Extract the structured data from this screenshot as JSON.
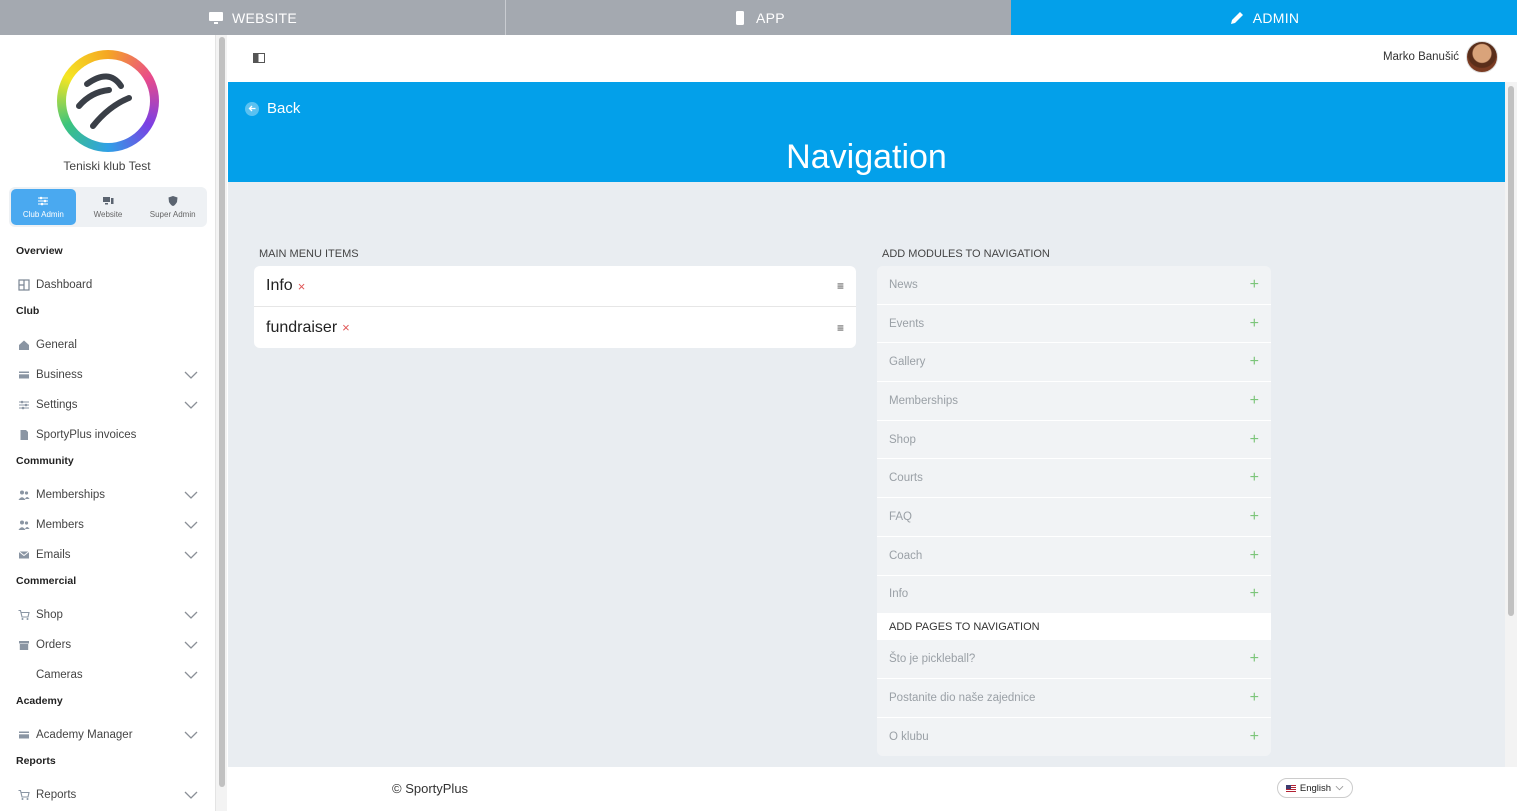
{
  "topbar": {
    "tabs": [
      {
        "label": "WEBSITE",
        "icon": "monitor-icon"
      },
      {
        "label": "APP",
        "icon": "phone-icon"
      },
      {
        "label": "ADMIN",
        "icon": "pencil-icon",
        "active": true
      }
    ],
    "active_color": "#03a0ea"
  },
  "sidebar": {
    "club_name": "Teniski klub Test",
    "modes": [
      {
        "label": "Club Admin",
        "icon": "sliders-icon",
        "active": true
      },
      {
        "label": "Website",
        "icon": "devices-icon"
      },
      {
        "label": "Super Admin",
        "icon": "shield-icon"
      }
    ],
    "sections": {
      "overview": "Overview",
      "club": "Club",
      "community": "Community",
      "commercial": "Commercial",
      "academy": "Academy",
      "reports": "Reports"
    },
    "items": {
      "dashboard": "Dashboard",
      "general": "General",
      "business": "Business",
      "settings": "Settings",
      "invoices": "SportyPlus invoices",
      "memberships": "Memberships",
      "members": "Members",
      "emails": "Emails",
      "shop": "Shop",
      "orders": "Orders",
      "cameras": "Cameras",
      "academy_manager": "Academy Manager",
      "reports": "Reports"
    }
  },
  "header": {
    "user_name": "Marko Banušić"
  },
  "banner": {
    "back_label": "Back",
    "title": "Navigation"
  },
  "main_menu": {
    "title": "MAIN MENU ITEMS",
    "items": [
      "Info",
      "fundraiser"
    ],
    "remove_symbol": "×",
    "drag_symbol": "≡"
  },
  "modules": {
    "title": "ADD MODULES TO NAVIGATION",
    "items": [
      "News",
      "Events",
      "Gallery",
      "Memberships",
      "Shop",
      "Courts",
      "FAQ",
      "Coach",
      "Info"
    ],
    "add_symbol": "+"
  },
  "pages": {
    "title": "ADD PAGES TO NAVIGATION",
    "items": [
      "Što je pickleball?",
      "Postanite dio naše zajednice",
      "O klubu"
    ]
  },
  "footer": {
    "copyright": "© SportyPlus",
    "language": "English"
  }
}
